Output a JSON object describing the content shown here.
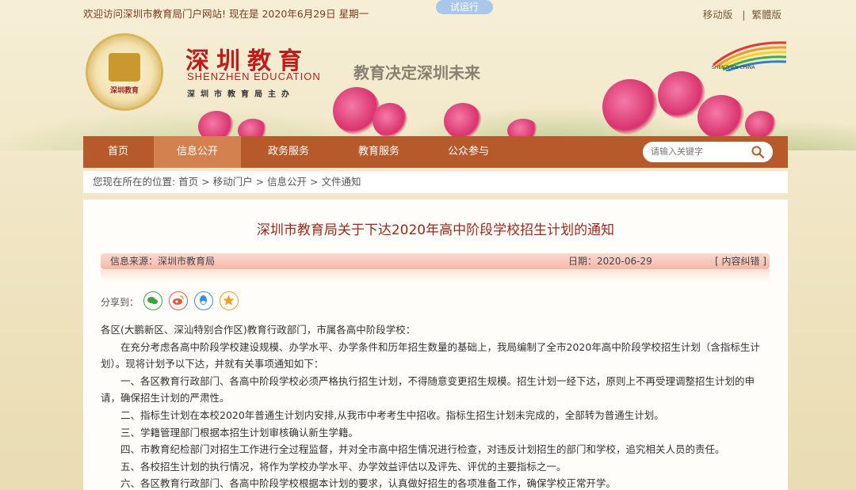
{
  "topbar": {
    "welcome": "欢迎访问深圳市教育局门户网站! 现在是  2020年6月29日  星期一",
    "trial_badge": "试运行",
    "mobile_link": "移动版",
    "separator": "|",
    "traditional_link": "繁體版"
  },
  "header": {
    "seal_text": "深圳教育",
    "site_name_cn": "深圳教育",
    "site_name_en": "SHENZHEN EDUCATION",
    "site_sub": "深圳市教育局主办",
    "slogan": "教育决定深圳未来",
    "brand_text": "SHENZHEN CHINA"
  },
  "nav": {
    "items": [
      {
        "label": "首页"
      },
      {
        "label": "信息公开"
      },
      {
        "label": "政务服务"
      },
      {
        "label": "教育服务"
      },
      {
        "label": "公众参与"
      }
    ],
    "active_index": 1,
    "search_placeholder": "请输入关键字"
  },
  "breadcrumb": "您现在所在的位置: 首页 > 移动门户 > 信息公开 > 文件通知",
  "article": {
    "title": "深圳市教育局关于下达2020年高中阶段学校招生计划的通知",
    "source": "信息来源：深圳市教育局",
    "date": "日期：2020-06-29",
    "correction_link": "[ 内容纠错 ]",
    "share_label": "分享到：",
    "share_buttons": [
      {
        "icon": "wechat-icon",
        "color": "#3aa63a"
      },
      {
        "icon": "weibo-icon",
        "color": "#e2573e"
      },
      {
        "icon": "qq-icon",
        "color": "#3b8fd8"
      },
      {
        "icon": "star-icon",
        "color": "#f0a020"
      }
    ],
    "paragraphs": [
      {
        "text": "各区(大鹏新区、深汕特别合作区)教育行政部门，市属各高中阶段学校：",
        "indent": false
      },
      {
        "text": "在充分考虑各高中阶段学校建设规模、办学水平、办学条件和历年招生数量的基础上，我局编制了全市2020年高中阶段学校招生计划（含指标生计划）。现将计划予以下达，并就有关事项通知如下：",
        "indent": true
      },
      {
        "text": "一、各区教育行政部门、各高中阶段学校必须严格执行招生计划，不得随意变更招生规模。招生计划一经下达，原则上不再受理调整招生计划的申请，确保招生计划的严肃性。",
        "indent": true
      },
      {
        "text": "二、指标生计划在本校2020年普通生计划内安排,从我市中考考生中招收。指标生招生计划未完成的，全部转为普通生计划。",
        "indent": true
      },
      {
        "text": "三、学籍管理部门根据本招生计划审核确认新生学籍。",
        "indent": true
      },
      {
        "text": "四、市教育纪检部门对招生工作进行全过程监督，并对全市高中招生情况进行检查，对违反计划招生的部门和学校，追究相关人员的责任。",
        "indent": true
      },
      {
        "text": "五、各校招生计划的执行情况，将作为学校办学水平、办学效益评估以及评先、评优的主要指标之一。",
        "indent": true
      },
      {
        "text": "六、各区教育行政部门、各高中阶段学校根据本计划的要求，认真做好招生的各项准备工作，确保学校正常开学。",
        "indent": true
      }
    ]
  }
}
